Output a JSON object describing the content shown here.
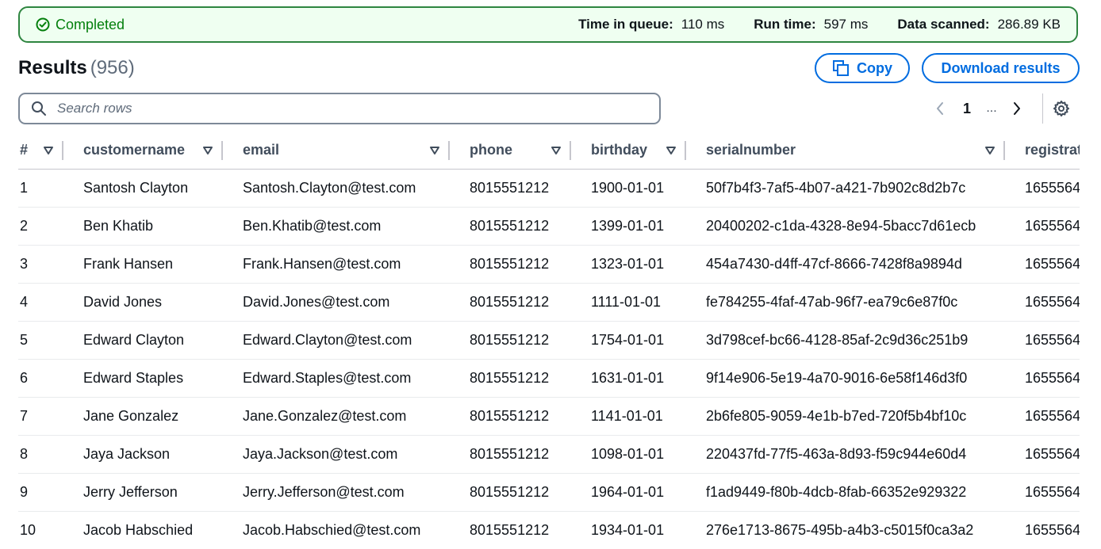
{
  "status": {
    "label": "Completed",
    "metrics": [
      {
        "label": "Time in queue:",
        "value": "110 ms"
      },
      {
        "label": "Run time:",
        "value": "597 ms"
      },
      {
        "label": "Data scanned:",
        "value": "286.89 KB"
      }
    ]
  },
  "results": {
    "title": "Results",
    "count": "(956)"
  },
  "buttons": {
    "copy": "Copy",
    "download": "Download results"
  },
  "search": {
    "placeholder": "Search rows"
  },
  "pagination": {
    "current": "1",
    "ellipsis": "..."
  },
  "table": {
    "columns": [
      "#",
      "customername",
      "email",
      "phone",
      "birthday",
      "serialnumber",
      "registrat"
    ],
    "rows": [
      [
        "1",
        "Santosh Clayton",
        "Santosh.Clayton@test.com",
        "8015551212",
        "1900-01-01",
        "50f7b4f3-7af5-4b07-a421-7b902c8d2b7c",
        "1655564"
      ],
      [
        "2",
        "Ben Khatib",
        "Ben.Khatib@test.com",
        "8015551212",
        "1399-01-01",
        "20400202-c1da-4328-8e94-5bacc7d61ecb",
        "1655564"
      ],
      [
        "3",
        "Frank Hansen",
        "Frank.Hansen@test.com",
        "8015551212",
        "1323-01-01",
        "454a7430-d4ff-47cf-8666-7428f8a9894d",
        "1655564"
      ],
      [
        "4",
        "David Jones",
        "David.Jones@test.com",
        "8015551212",
        "1111-01-01",
        "fe784255-4faf-47ab-96f7-ea79c6e87f0c",
        "1655564"
      ],
      [
        "5",
        "Edward Clayton",
        "Edward.Clayton@test.com",
        "8015551212",
        "1754-01-01",
        "3d798cef-bc66-4128-85af-2c9d36c251b9",
        "1655564"
      ],
      [
        "6",
        "Edward Staples",
        "Edward.Staples@test.com",
        "8015551212",
        "1631-01-01",
        "9f14e906-5e19-4a70-9016-6e58f146d3f0",
        "1655564"
      ],
      [
        "7",
        "Jane Gonzalez",
        "Jane.Gonzalez@test.com",
        "8015551212",
        "1141-01-01",
        "2b6fe805-9059-4e1b-b7ed-720f5b4bf10c",
        "1655564"
      ],
      [
        "8",
        "Jaya Jackson",
        "Jaya.Jackson@test.com",
        "8015551212",
        "1098-01-01",
        "220437fd-77f5-463a-8d93-f59c944e60d4",
        "1655564"
      ],
      [
        "9",
        "Jerry Jefferson",
        "Jerry.Jefferson@test.com",
        "8015551212",
        "1964-01-01",
        "f1ad9449-f80b-4dcb-8fab-66352e929322",
        "1655564"
      ],
      [
        "10",
        "Jacob Habschied",
        "Jacob.Habschied@test.com",
        "8015551212",
        "1934-01-01",
        "276e1713-8675-495b-a4b3-c5015f0ca3a2",
        "1655564"
      ]
    ]
  },
  "icons": {
    "status": "check-circle-icon",
    "copy": "copy-icon",
    "search": "search-icon",
    "prev": "chevron-left-icon",
    "next": "chevron-right-icon",
    "settings": "gear-icon",
    "sort": "caret-down-icon"
  },
  "colors": {
    "success": "#037f0c",
    "accent": "#006ce0",
    "status_bg": "#effff1"
  }
}
